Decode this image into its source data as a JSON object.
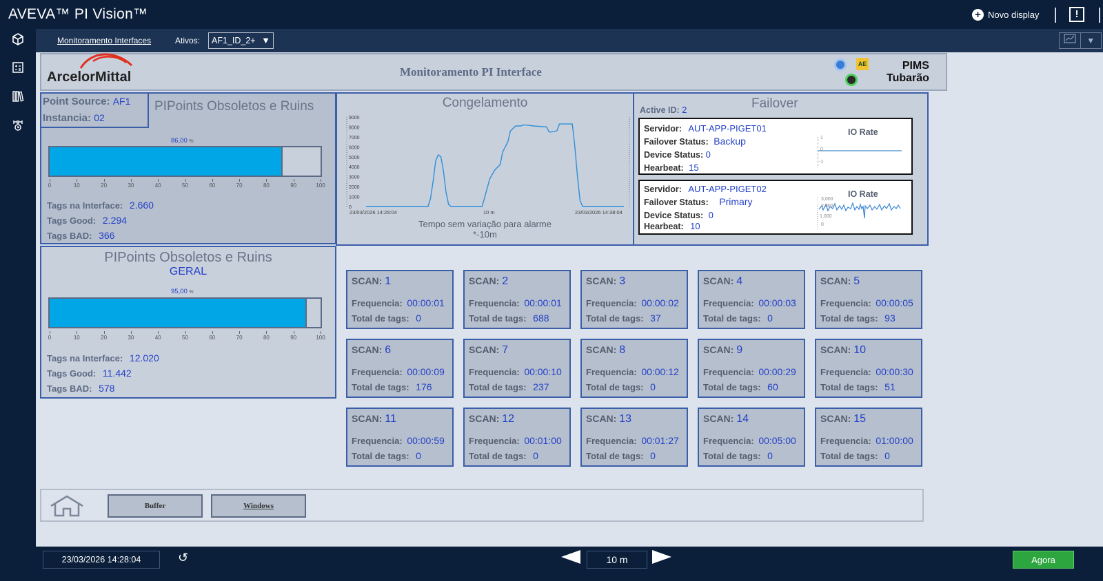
{
  "app": {
    "title": "AVEVA™ PI Vision™",
    "new_display": "Novo display",
    "alert_glyph": "!"
  },
  "sidebar": {
    "icons": [
      "cube-icon",
      "calculator-icon",
      "library-icon",
      "asset-tree-icon"
    ]
  },
  "toolbar": {
    "breadcrumb": "Monitoramento Interfaces",
    "assets_label": "Ativos:",
    "assets_value": "AF1_ID_2+"
  },
  "header": {
    "logo": "ArcelorMittal",
    "title": "Monitoramento PI Interface",
    "pims_line1": "PIMS",
    "pims_line2": "Tubarão",
    "ae_badge": "AE"
  },
  "interface_panel": {
    "point_source_label": "Point Source:",
    "point_source": "AF1",
    "instancia_label": "Instancia:",
    "instancia": "02",
    "title": "PIPoints Obsoletos e Ruins",
    "percent": "86,00",
    "percent_unit": "%",
    "fill_fraction": 0.86,
    "axis_ticks": [
      "0",
      "10",
      "20",
      "30",
      "40",
      "50",
      "60",
      "70",
      "80",
      "90",
      "100"
    ],
    "tags_interface_label": "Tags na Interface:",
    "tags_interface": "2.660",
    "tags_good_label": "Tags Good:",
    "tags_good": "2.294",
    "tags_bad_label": "Tags BAD:",
    "tags_bad": "366"
  },
  "geral_panel": {
    "title": "PIPoints Obsoletos e Ruins",
    "subtitle": "GERAL",
    "percent": "95,00",
    "percent_unit": "%",
    "fill_fraction": 0.95,
    "tags_interface_label": "Tags na Interface:",
    "tags_interface": "12.020",
    "tags_good_label": "Tags Good:",
    "tags_good": "11.442",
    "tags_bad_label": "Tags BAD:",
    "tags_bad": "578"
  },
  "congelamento": {
    "title": "Congelamento",
    "start": "23/03/2026 14:28:04",
    "mid": "10 m",
    "end": "23/03/2026 14:38:04",
    "caption": "Tempo sem variação para alarme",
    "caption2": "*-10m"
  },
  "chart_data": {
    "type": "line",
    "ylim": [
      0,
      9000
    ],
    "yticks": [
      "9000",
      "8000",
      "7000",
      "6000",
      "5000",
      "4000",
      "3000",
      "2000",
      "1000",
      "0"
    ],
    "x": [
      0,
      0.24,
      0.25,
      0.26,
      0.27,
      0.28,
      0.29,
      0.3,
      0.31,
      0.32,
      0.33,
      0.34,
      0.45,
      0.46,
      0.48,
      0.5,
      0.52,
      0.53,
      0.55,
      0.56,
      0.58,
      0.6,
      0.61,
      0.62,
      0.65,
      0.7,
      0.71,
      0.72,
      0.74,
      0.75,
      0.76,
      0.78,
      0.8,
      0.81,
      0.82,
      0.83,
      0.84,
      1.0
    ],
    "values": [
      0,
      0,
      800,
      2500,
      4600,
      5200,
      5000,
      3600,
      1500,
      200,
      0,
      0,
      0,
      900,
      2800,
      3700,
      4200,
      5500,
      6500,
      7600,
      8100,
      8100,
      8200,
      8200,
      8100,
      8000,
      7500,
      7500,
      7600,
      8300,
      8300,
      8300,
      8300,
      6000,
      3000,
      600,
      0,
      0
    ]
  },
  "failover": {
    "title": "Failover",
    "active_id_label": "Active ID:",
    "active_id": "2",
    "servers": [
      {
        "servidor_label": "Servidor:",
        "servidor": "AUT-APP-PIGET01",
        "status_label": "Failover Status:",
        "status": "Backup",
        "device_label": "Device Status:",
        "device": "0",
        "heartbeat_label": "Hearbeat:",
        "heartbeat": "15",
        "io_label": "IO Rate",
        "io_ticks": [
          "1",
          "0",
          "-1"
        ]
      },
      {
        "servidor_label": "Servidor:",
        "servidor": "AUT-APP-PIGET02",
        "status_label": "Failover Status:",
        "status": "Primary",
        "device_label": "Device Status:",
        "device": "0",
        "heartbeat_label": "Hearbeat:",
        "heartbeat": "10",
        "io_label": "IO Rate",
        "io_ticks": [
          "3,000",
          "2,000",
          "1,000",
          "0"
        ]
      }
    ]
  },
  "scans": [
    {
      "label": "SCAN:",
      "num": "1",
      "freq_label": "Frequencia:",
      "freq": "00:00:01",
      "tags_label": "Total de tags:",
      "tags": "0"
    },
    {
      "label": "SCAN:",
      "num": "2",
      "freq_label": "Frequencia:",
      "freq": "00:00:01",
      "tags_label": "Total de tags:",
      "tags": "688"
    },
    {
      "label": "SCAN:",
      "num": "3",
      "freq_label": "Frequencia:",
      "freq": "00:00:02",
      "tags_label": "Total de tags:",
      "tags": "37"
    },
    {
      "label": "SCAN:",
      "num": "4",
      "freq_label": "Frequencia:",
      "freq": "00:00:03",
      "tags_label": "Total de tags:",
      "tags": "0"
    },
    {
      "label": "SCAN:",
      "num": "5",
      "freq_label": "Frequencia:",
      "freq": "00:00:05",
      "tags_label": "Total de tags:",
      "tags": "93"
    },
    {
      "label": "SCAN:",
      "num": "6",
      "freq_label": "Frequencia:",
      "freq": "00:00:09",
      "tags_label": "Total de tags:",
      "tags": "176"
    },
    {
      "label": "SCAN:",
      "num": "7",
      "freq_label": "Frequencia:",
      "freq": "00:00:10",
      "tags_label": "Total de tags:",
      "tags": "237"
    },
    {
      "label": "SCAN:",
      "num": "8",
      "freq_label": "Frequencia:",
      "freq": "00:00:12",
      "tags_label": "Total de tags:",
      "tags": "0"
    },
    {
      "label": "SCAN:",
      "num": "9",
      "freq_label": "Frequencia:",
      "freq": "00:00:29",
      "tags_label": "Total de tags:",
      "tags": "60"
    },
    {
      "label": "SCAN:",
      "num": "10",
      "freq_label": "Frequencia:",
      "freq": "00:00:30",
      "tags_label": "Total de tags:",
      "tags": "51"
    },
    {
      "label": "SCAN:",
      "num": "11",
      "freq_label": "Frequencia:",
      "freq": "00:00:59",
      "tags_label": "Total de tags:",
      "tags": "0"
    },
    {
      "label": "SCAN:",
      "num": "12",
      "freq_label": "Frequencia:",
      "freq": "00:01:00",
      "tags_label": "Total de tags:",
      "tags": "0"
    },
    {
      "label": "SCAN:",
      "num": "13",
      "freq_label": "Frequencia:",
      "freq": "00:01:27",
      "tags_label": "Total de tags:",
      "tags": "0"
    },
    {
      "label": "SCAN:",
      "num": "14",
      "freq_label": "Frequencia:",
      "freq": "00:05:00",
      "tags_label": "Total de tags:",
      "tags": "0"
    },
    {
      "label": "SCAN:",
      "num": "15",
      "freq_label": "Frequencia:",
      "freq": "01:00:00",
      "tags_label": "Total de tags:",
      "tags": "0"
    }
  ],
  "nav": {
    "buffer": "Buffer",
    "windows": "Windows"
  },
  "footer": {
    "time": "23/03/2026 14:28:04",
    "range": "10 m",
    "now": "Agora",
    "refresh_glyph": "↺"
  },
  "colors": {
    "accent": "#00a6e6",
    "value_text": "#2440c8",
    "border": "#3b5ea9",
    "now_button": "#2ea640",
    "brand_arc": "#e2301f"
  }
}
